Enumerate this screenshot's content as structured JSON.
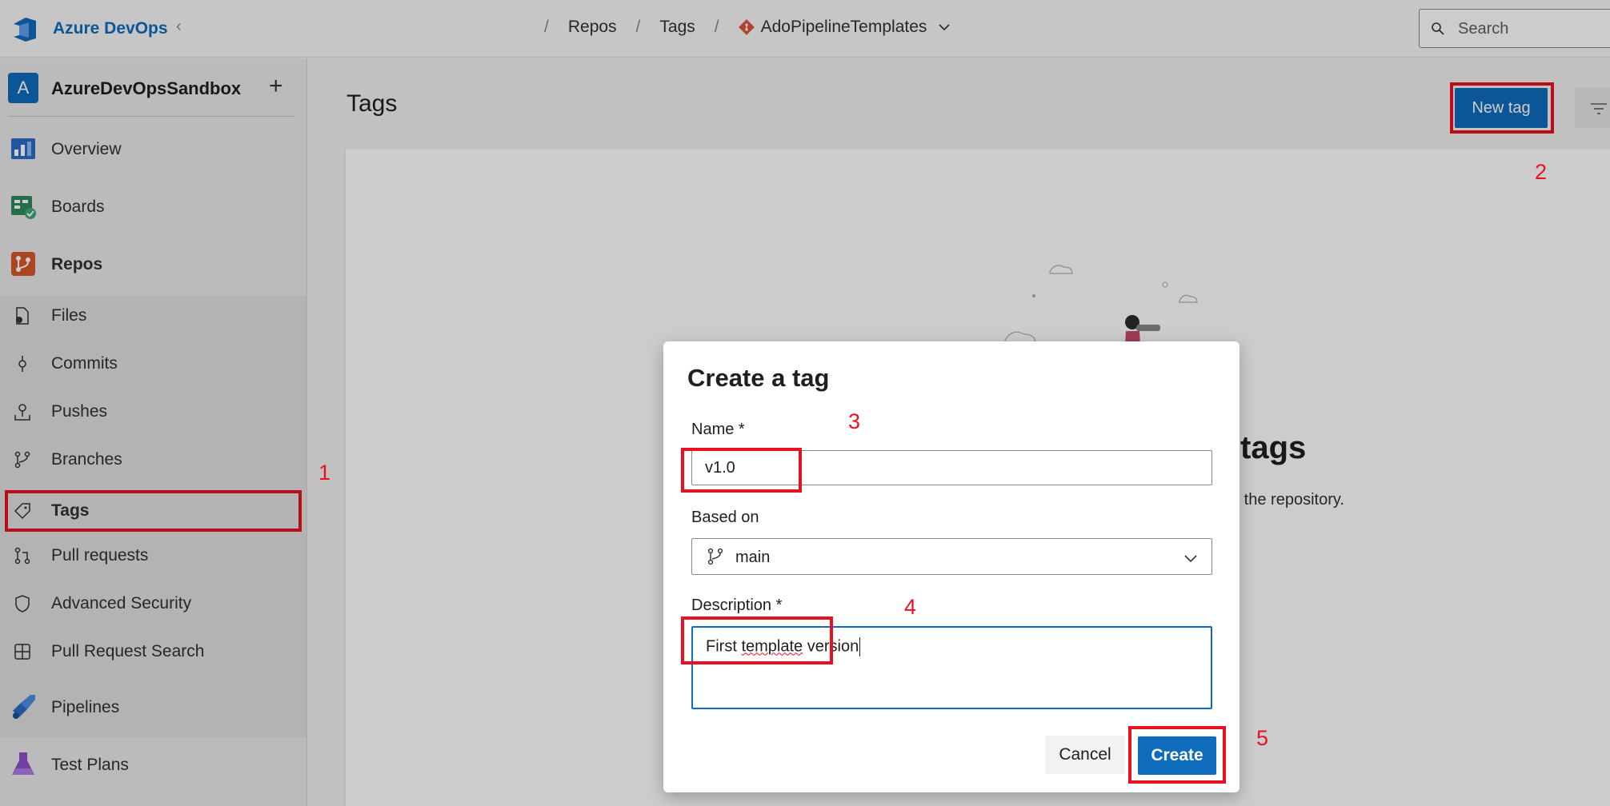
{
  "topbar": {
    "brand": "Azure DevOps",
    "brand_separator": "‹",
    "breadcrumbs": [
      "Repos",
      "Tags",
      "AdoPipelineTemplates"
    ],
    "search_placeholder": "Search"
  },
  "sidebar": {
    "project_initial": "A",
    "project_name": "AzureDevOpsSandbox",
    "add_symbol": "+",
    "items": [
      {
        "label": "Overview",
        "icon": "overview-icon"
      },
      {
        "label": "Boards",
        "icon": "boards-icon"
      },
      {
        "label": "Repos",
        "icon": "repos-icon"
      },
      {
        "label": "Files",
        "icon": "files-icon"
      },
      {
        "label": "Commits",
        "icon": "commits-icon"
      },
      {
        "label": "Pushes",
        "icon": "pushes-icon"
      },
      {
        "label": "Branches",
        "icon": "branches-icon"
      },
      {
        "label": "Tags",
        "icon": "tag-icon"
      },
      {
        "label": "Pull requests",
        "icon": "pull-requests-icon"
      },
      {
        "label": "Advanced Security",
        "icon": "shield-icon"
      },
      {
        "label": "Pull Request Search",
        "icon": "grid-icon"
      },
      {
        "label": "Pipelines",
        "icon": "pipelines-icon"
      },
      {
        "label": "Test Plans",
        "icon": "test-plans-icon"
      }
    ]
  },
  "main": {
    "title": "Tags",
    "new_tag_label": "New tag",
    "empty_title": "tags",
    "empty_subtitle": "o the repository."
  },
  "dialog": {
    "title": "Create a tag",
    "name_label": "Name *",
    "name_value": "v1.0",
    "based_on_label": "Based on",
    "based_on_value": "main",
    "description_label": "Description *",
    "description_value_part1": "First ",
    "description_value_part2": "template",
    "description_value_part3": " version",
    "cancel_label": "Cancel",
    "create_label": "Create"
  },
  "annotations": [
    "1",
    "2",
    "3",
    "4",
    "5"
  ],
  "colors": {
    "accent": "#0f6cbd",
    "annotation": "#e81123"
  }
}
